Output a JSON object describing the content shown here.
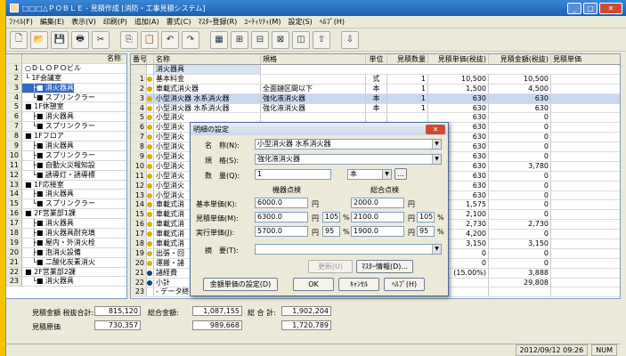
{
  "window": {
    "title": "□□□△ＰＯＢＬＥ - 見積作成 [消防・工事見積システム]"
  },
  "menu": [
    "ﾌｧｲﾙ(F)",
    "編集(E)",
    "表示(V)",
    "印刷(P)",
    "追加(A)",
    "書式(C)",
    "ﾏｽﾀｰ登録(R)",
    "ﾕｰﾃｨﾘﾃｨ(M)",
    "設定(S)",
    "ﾍﾙﾌﾟ(H)"
  ],
  "toolbar": [
    "new-doc",
    "open-folder",
    "save",
    "print",
    "cut",
    "copy",
    "paste",
    "undo",
    "redo",
    "chart",
    "calc1",
    "calc2",
    "calc3",
    "window",
    "up",
    "down"
  ],
  "tree": {
    "header": "名称",
    "rows": [
      {
        "n": "1",
        "label": "○ＤＬＯＰＯビル"
      },
      {
        "n": "2",
        "label": "└ 1F会議室"
      },
      {
        "n": "3",
        "label": "　├■ 消火器具",
        "sel": true
      },
      {
        "n": "4",
        "label": "　└■ スプリンクラー"
      },
      {
        "n": "5",
        "label": "■ 1F休憩室"
      },
      {
        "n": "6",
        "label": "　├■ 消火器具"
      },
      {
        "n": "7",
        "label": "　└■ スプリンクラー"
      },
      {
        "n": "8",
        "label": "■ 1Fフロア"
      },
      {
        "n": "9",
        "label": "　├■ 消火器具"
      },
      {
        "n": "10",
        "label": "　├■ スプリンクラー"
      },
      {
        "n": "11",
        "label": "　├■ 自動火災報知設"
      },
      {
        "n": "12",
        "label": "　└■ 誘導灯・誘導標"
      },
      {
        "n": "13",
        "label": "■ 1F応接室"
      },
      {
        "n": "14",
        "label": "　├■ 消火器具"
      },
      {
        "n": "15",
        "label": "　└■ スプリンクラー"
      },
      {
        "n": "16",
        "label": "■ 2F営業部1課"
      },
      {
        "n": "17",
        "label": "　├■ 消火器具"
      },
      {
        "n": "18",
        "label": "　├■ 消火器具耐充填"
      },
      {
        "n": "19",
        "label": "　├■ 屋内・外消火栓"
      },
      {
        "n": "20",
        "label": "　├■ 泡消火設備"
      },
      {
        "n": "21",
        "label": "　└■ 二酸化炭素消火"
      },
      {
        "n": "22",
        "label": "■ 2F営業部2課"
      },
      {
        "n": "23",
        "label": "　└■ 消火器具"
      }
    ]
  },
  "grid": {
    "headers": [
      "番号",
      "",
      "名称",
      "規格",
      "単位",
      "見積数量",
      "見積単価(税抜)",
      "見積金額(税抜)",
      "見積単価"
    ],
    "section_title": "消火器具",
    "rows": [
      {
        "n": "1",
        "dot": "y",
        "name": "基本料金",
        "spec": "",
        "unit": "式",
        "qty": "1",
        "price": "10,500",
        "amount": "10,500"
      },
      {
        "n": "2",
        "dot": "y",
        "name": "車載式消火器",
        "spec": "全面鏈区間以下",
        "unit": "本",
        "qty": "1",
        "price": "1,500",
        "amount": "4,500"
      },
      {
        "n": "3",
        "dot": "y",
        "name": "小型消火器 水系消火器",
        "spec": "強化液消火器",
        "unit": "本",
        "qty": "1",
        "price": "630",
        "amount": "630",
        "sel": true
      },
      {
        "n": "4",
        "dot": "y",
        "name": "小型消火器 水系消火器",
        "spec": "強化液消火器",
        "unit": "本",
        "qty": "1",
        "price": "630",
        "amount": "630"
      },
      {
        "n": "5",
        "dot": "y",
        "name": "小型消火",
        "spec": "",
        "unit": "",
        "qty": "",
        "price": "630",
        "amount": "0"
      },
      {
        "n": "6",
        "dot": "y",
        "name": "小型消火",
        "spec": "",
        "unit": "",
        "qty": "",
        "price": "630",
        "amount": "0"
      },
      {
        "n": "7",
        "dot": "y",
        "name": "小型消火",
        "spec": "",
        "unit": "",
        "qty": "",
        "price": "630",
        "amount": "0"
      },
      {
        "n": "8",
        "dot": "y",
        "name": "小型消火",
        "spec": "",
        "unit": "",
        "qty": "",
        "price": "630",
        "amount": "0"
      },
      {
        "n": "9",
        "dot": "y",
        "name": "小型消火",
        "spec": "",
        "unit": "",
        "qty": "",
        "price": "630",
        "amount": "0"
      },
      {
        "n": "10",
        "dot": "y",
        "name": "小型消火",
        "spec": "",
        "unit": "",
        "qty": "",
        "price": "630",
        "amount": "3,780"
      },
      {
        "n": "11",
        "dot": "y",
        "name": "小型消火",
        "spec": "",
        "unit": "",
        "qty": "",
        "price": "630",
        "amount": "0"
      },
      {
        "n": "12",
        "dot": "y",
        "name": "小型消火",
        "spec": "",
        "unit": "",
        "qty": "",
        "price": "630",
        "amount": "0"
      },
      {
        "n": "13",
        "dot": "y",
        "name": "小型消火",
        "spec": "",
        "unit": "",
        "qty": "",
        "price": "630",
        "amount": "0"
      },
      {
        "n": "14",
        "dot": "y",
        "name": "車載式消",
        "spec": "",
        "unit": "",
        "qty": "",
        "price": "1,575",
        "amount": "0"
      },
      {
        "n": "15",
        "dot": "y",
        "name": "車載式消",
        "spec": "",
        "unit": "",
        "qty": "",
        "price": "2,100",
        "amount": "0"
      },
      {
        "n": "16",
        "dot": "y",
        "name": "車載式消",
        "spec": "",
        "unit": "",
        "qty": "",
        "price": "2,730",
        "amount": "2,730"
      },
      {
        "n": "17",
        "dot": "y",
        "name": "車載式消",
        "spec": "",
        "unit": "",
        "qty": "",
        "price": "4,200",
        "amount": "0"
      },
      {
        "n": "18",
        "dot": "y",
        "name": "車載式消",
        "spec": "",
        "unit": "",
        "qty": "",
        "price": "3,150",
        "amount": "3,150"
      },
      {
        "n": "19",
        "dot": "y",
        "name": "出張・回",
        "spec": "",
        "unit": "",
        "qty": "",
        "price": "0",
        "amount": "0"
      },
      {
        "n": "20",
        "dot": "y",
        "name": "運搬・諸",
        "spec": "",
        "unit": "",
        "qty": "",
        "price": "0",
        "amount": "0"
      },
      {
        "n": "21",
        "dot": "b",
        "name": "諸経費",
        "spec": "",
        "unit": "",
        "qty": "1",
        "price": "(15.00%)",
        "amount": "3,888"
      },
      {
        "n": "22",
        "dot": "b",
        "name": "小計",
        "spec": "",
        "unit": "",
        "qty": "",
        "price": "",
        "amount": "29,808"
      },
      {
        "n": "23",
        "dot": "",
        "name": "- データ終わり -",
        "spec": "",
        "unit": "",
        "qty": "",
        "price": "",
        "amount": ""
      }
    ]
  },
  "summary": {
    "l1": "見積金額 税抜合計:",
    "v1": "815,120",
    "l2": "総合金額:",
    "v2": "1,087,155",
    "l3": "総 合 計:",
    "v3": "1,902,204",
    "l4": "見積原価",
    "v4": "730,357",
    "v5": "989,668",
    "v6": "1,720,789"
  },
  "status": {
    "datetime": "2012/09/12 09:26",
    "num": "NUM"
  },
  "dialog": {
    "title": "明細の設定",
    "name_label": "名　称(N):",
    "name_value": "小型消火器 水系消火器",
    "spec_label": "規　格(S):",
    "spec_value": "強化液消火器",
    "qty_label": "数　量(Q):",
    "qty_value": "1",
    "unit_value": "本",
    "col1": "機器点検",
    "col2": "総合点検",
    "base_label": "基本単価(K):",
    "base1": "6000.0",
    "base2": "2000.0",
    "yen": "円",
    "est_label": "見積単価(M):",
    "est1": "6300.0",
    "pct1": "105",
    "est2": "2100.0",
    "pct2": "105",
    "real_label": "実行単価(J):",
    "real1": "5700.0",
    "pct3": "95",
    "real2": "1900.0",
    "pct4": "95",
    "memo_label": "摘　要(T):",
    "memo_value": "",
    "pct": "%",
    "update_btn": "更新(U)",
    "master_btn": "ﾏｽﾀｰ情報(D)...",
    "reset_btn": "金額単価の設定(D)",
    "ok_btn": "OK",
    "cancel_btn": "ｷｬﾝｾﾙ",
    "help_btn": "ﾍﾙﾌﾟ(H)"
  }
}
